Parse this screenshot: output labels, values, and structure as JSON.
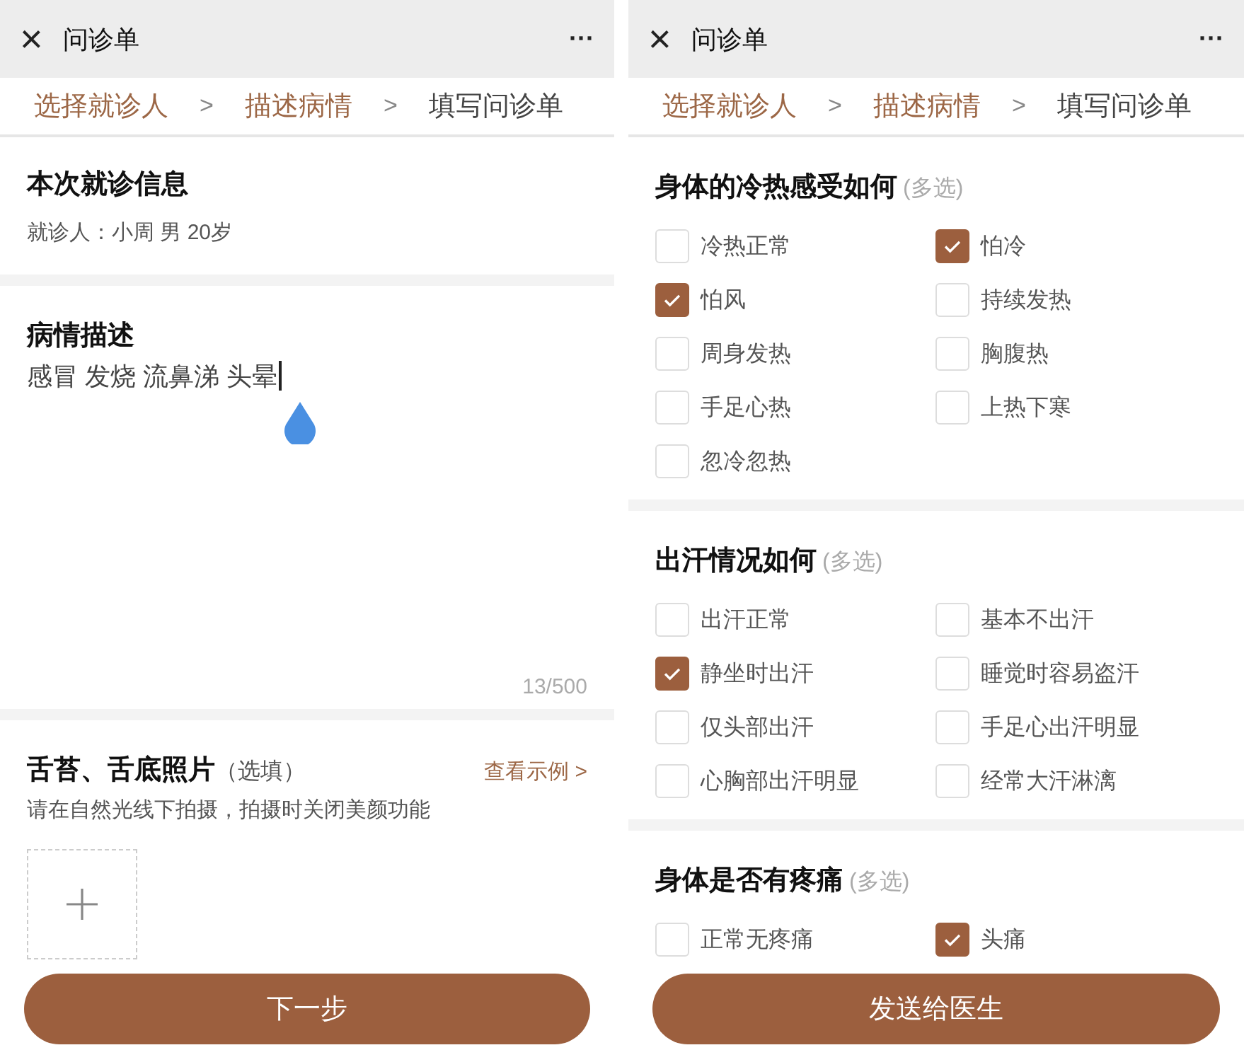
{
  "panels": [
    {
      "header": {
        "close": "×",
        "title": "问诊单",
        "more": "···"
      },
      "steps": [
        {
          "label": "选择就诊人",
          "completed": true
        },
        {
          "label": "描述病情",
          "completed": true
        },
        {
          "label": "填写问诊单",
          "completed": false
        }
      ],
      "step_separator": ">",
      "visit_info": {
        "title": "本次就诊信息",
        "patient": "就诊人：小周 男 20岁"
      },
      "description": {
        "title": "病情描述",
        "text": "感冒 发烧 流鼻涕 头晕",
        "counter": "13/500"
      },
      "photos": {
        "title": "舌苔、舌底照片",
        "note": "（选填）",
        "example_link": "查看示例 >",
        "hint": "请在自然光线下拍摄，拍摄时关闭美颜功能"
      },
      "button": "下一步"
    },
    {
      "header": {
        "close": "×",
        "title": "问诊单",
        "more": "···"
      },
      "steps": [
        {
          "label": "选择就诊人",
          "completed": true
        },
        {
          "label": "描述病情",
          "completed": true
        },
        {
          "label": "填写问诊单",
          "completed": false
        }
      ],
      "step_separator": ">",
      "questions": [
        {
          "title": "身体的冷热感受如何",
          "note": "(多选)",
          "options": [
            {
              "label": "冷热正常",
              "checked": false
            },
            {
              "label": "怕冷",
              "checked": true
            },
            {
              "label": "怕风",
              "checked": true
            },
            {
              "label": "持续发热",
              "checked": false
            },
            {
              "label": "周身发热",
              "checked": false
            },
            {
              "label": "胸腹热",
              "checked": false
            },
            {
              "label": "手足心热",
              "checked": false
            },
            {
              "label": "上热下寒",
              "checked": false
            },
            {
              "label": "忽冷忽热",
              "checked": false
            }
          ]
        },
        {
          "title": "出汗情况如何",
          "note": "(多选)",
          "options": [
            {
              "label": "出汗正常",
              "checked": false
            },
            {
              "label": "基本不出汗",
              "checked": false
            },
            {
              "label": "静坐时出汗",
              "checked": true
            },
            {
              "label": "睡觉时容易盗汗",
              "checked": false
            },
            {
              "label": "仅头部出汗",
              "checked": false
            },
            {
              "label": "手足心出汗明显",
              "checked": false
            },
            {
              "label": "心胸部出汗明显",
              "checked": false
            },
            {
              "label": "经常大汗淋漓",
              "checked": false
            }
          ]
        },
        {
          "title": "身体是否有疼痛",
          "note": "(多选)",
          "options": [
            {
              "label": "正常无疼痛",
              "checked": false
            },
            {
              "label": "头痛",
              "checked": true
            }
          ]
        }
      ],
      "button": "发送给医生"
    }
  ]
}
